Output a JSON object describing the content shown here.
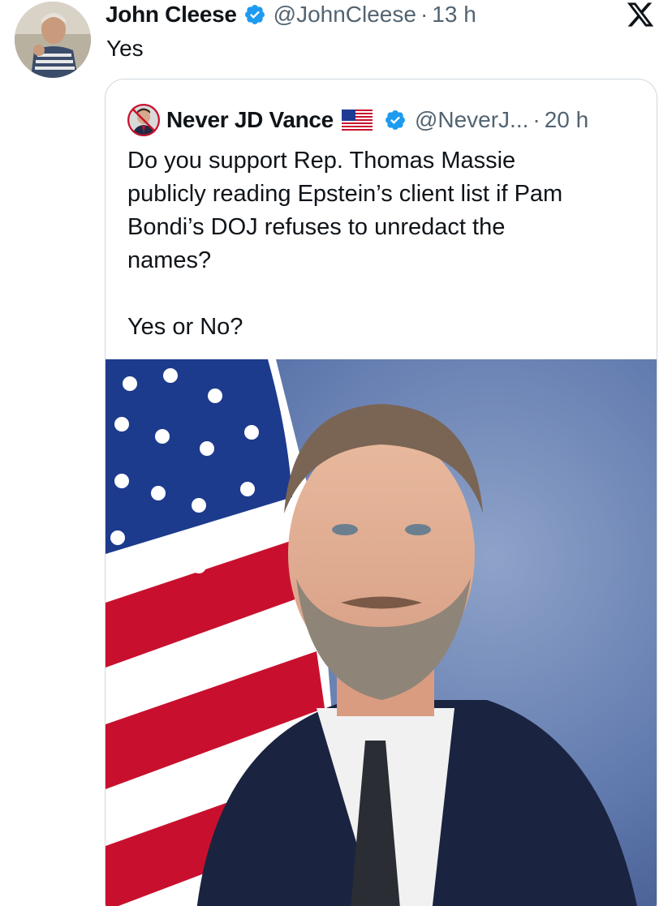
{
  "tweet": {
    "author_name": "John Cleese",
    "author_handle": "@JohnCleese",
    "separator": "·",
    "time": "13 h",
    "text": "Yes",
    "verified": true
  },
  "quoted_tweet": {
    "author_name": "Never JD Vance",
    "author_handle": "@NeverJ...",
    "separator": "·",
    "time": "20 h",
    "verified": true,
    "flag_icon": "us-flag-icon",
    "body_lines": [
      "Do you support Rep. Thomas Massie",
      "publicly reading Epstein’s client list if Pam",
      "Bondi’s DOJ refuses to unredact the",
      "names?"
    ],
    "body_second_paragraph": "Yes or No?"
  },
  "icons": {
    "verified": "verified-badge-icon",
    "brand": "x-logo-icon"
  },
  "colors": {
    "text": "#0f1419",
    "secondary_text": "#536471",
    "verified_blue": "#1d9bf0",
    "card_border": "#cfd9de"
  }
}
